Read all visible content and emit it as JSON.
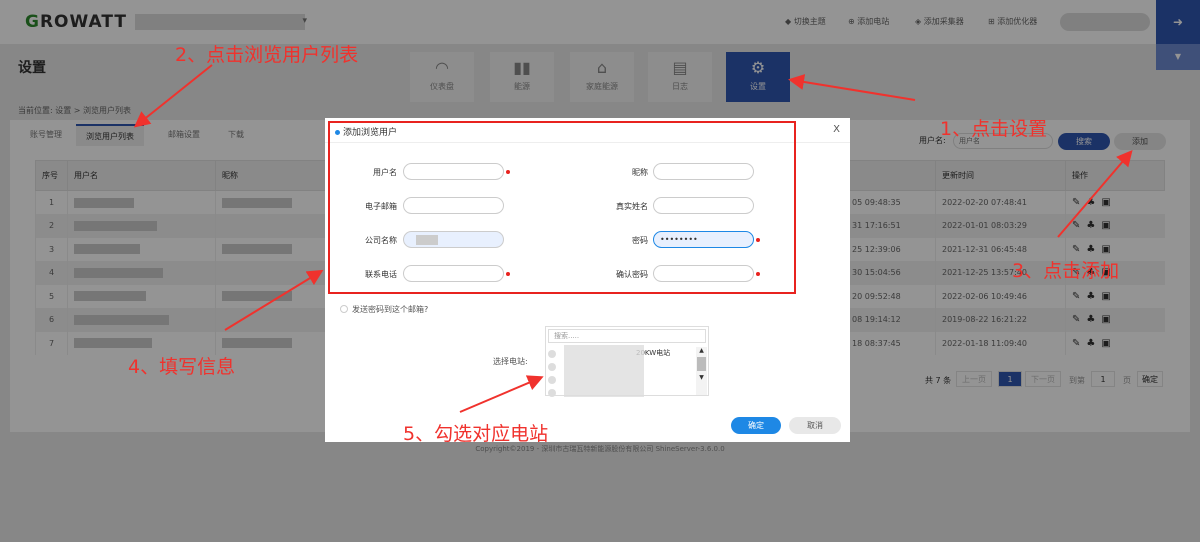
{
  "header": {
    "logo_prefix": "G",
    "logo_rest": "ROWATT",
    "links": [
      "切换主题",
      "添加电站",
      "添加采集器",
      "添加优化器"
    ]
  },
  "page": {
    "title": "设置",
    "breadcrumb": "当前位置: 设置 > 浏览用户列表"
  },
  "nav": [
    {
      "label": "仪表盘",
      "icon": "gauge-icon"
    },
    {
      "label": "能源",
      "icon": "bar-chart-icon"
    },
    {
      "label": "家庭能源",
      "icon": "home-icon"
    },
    {
      "label": "日志",
      "icon": "log-icon"
    },
    {
      "label": "设置",
      "icon": "gear-icon"
    }
  ],
  "tabs": [
    "账号管理",
    "浏览用户列表",
    "邮箱设置",
    "下载"
  ],
  "search": {
    "label": "用户名:",
    "placeholder": "用户名",
    "search_btn": "搜索",
    "add_btn": "添加"
  },
  "table": {
    "headers": [
      "序号",
      "用户名",
      "昵称",
      "更新时间",
      "操作"
    ],
    "rows": [
      {
        "no": "1",
        "created": "05 09:48:35",
        "updated": "2022-02-20 07:48:41"
      },
      {
        "no": "2",
        "created": "31 17:16:51",
        "updated": "2022-01-01 08:03:29"
      },
      {
        "no": "3",
        "created": "25 12:39:06",
        "updated": "2021-12-31 06:45:48"
      },
      {
        "no": "4",
        "created": "30 15:04:56",
        "updated": "2021-12-25 13:57:40"
      },
      {
        "no": "5",
        "created": "20 09:52:48",
        "updated": "2022-02-06 10:49:46"
      },
      {
        "no": "6",
        "created": "08 19:14:12",
        "updated": "2019-08-22 16:21:22"
      },
      {
        "no": "7",
        "created": "18 08:37:45",
        "updated": "2022-01-18 11:09:40"
      }
    ]
  },
  "pagination": {
    "total": "共 7 条",
    "prev": "上一页",
    "current": "1",
    "next": "下一页",
    "goto": "到第",
    "page_input": "1",
    "page_unit": "页",
    "confirm": "确定"
  },
  "footer": "Copyright©2019 - 深圳市古瑞瓦特新能源股份有限公司 ShineServer-3.6.0.0",
  "modal": {
    "title": "添加浏览用户",
    "close": "X",
    "fields": {
      "username": "用户名",
      "nickname": "昵称",
      "email": "电子邮箱",
      "realname": "真实姓名",
      "company": "公司名称",
      "password": "密码",
      "password_value": "••••••••",
      "phone": "联系电话",
      "confirm_password": "确认密码"
    },
    "send_email": "发送密码到这个邮箱?",
    "station_label": "选择电站:",
    "station_search": "搜索.....",
    "station_item": "20KW电站",
    "ok": "确定",
    "cancel": "取消"
  },
  "annotations": [
    "1、点击设置",
    "2、点击浏览用户列表",
    "3、点击添加",
    "4、填写信息",
    "5、勾选对应电站"
  ],
  "colors": {
    "brand": "#2f56b0",
    "annotation": "#f0322d"
  }
}
